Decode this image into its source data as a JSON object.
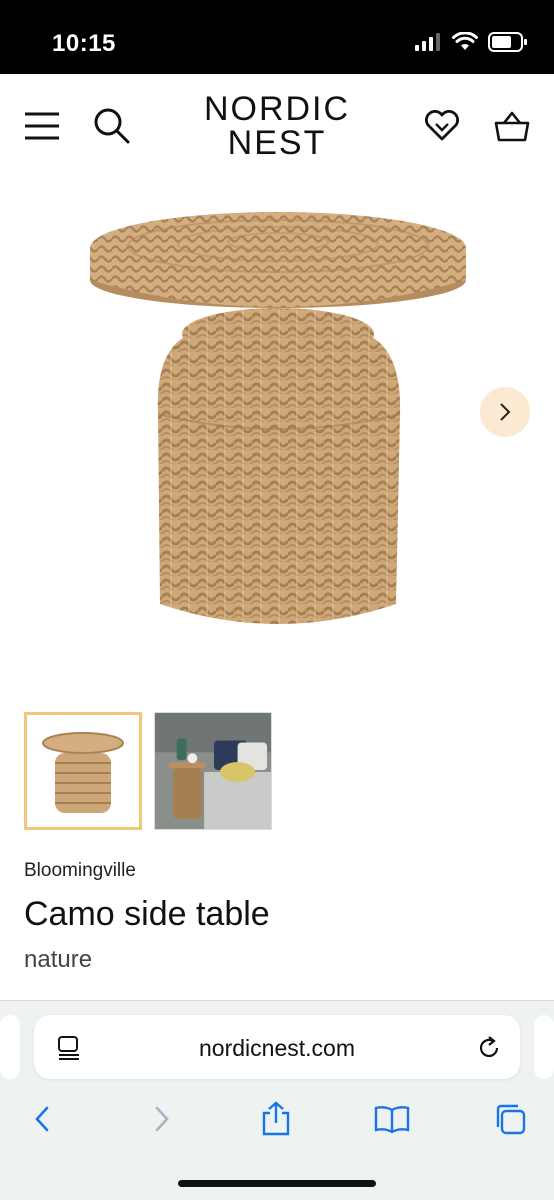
{
  "status_bar": {
    "time": "10:15"
  },
  "header": {
    "logo_line1": "NORDIC",
    "logo_line2": "NEST",
    "icons": [
      "menu-icon",
      "search-icon",
      "wishlist-heart-icon",
      "basket-icon"
    ]
  },
  "gallery": {
    "next_icon": "chevron-right-icon",
    "thumbnails": [
      "side-table-product-photo",
      "side-table-room-photo"
    ],
    "active_thumbnail": 0,
    "accent_color": "#f0c77e"
  },
  "product": {
    "brand": "Bloomingville",
    "title": "Camo side table",
    "variant": "nature"
  },
  "browser": {
    "url": "nordicnest.com",
    "icons": [
      "page-format-icon",
      "reload-icon",
      "back-icon",
      "forward-icon",
      "share-icon",
      "bookmarks-icon",
      "tabs-icon"
    ],
    "tint_color": "#1a73e8"
  }
}
